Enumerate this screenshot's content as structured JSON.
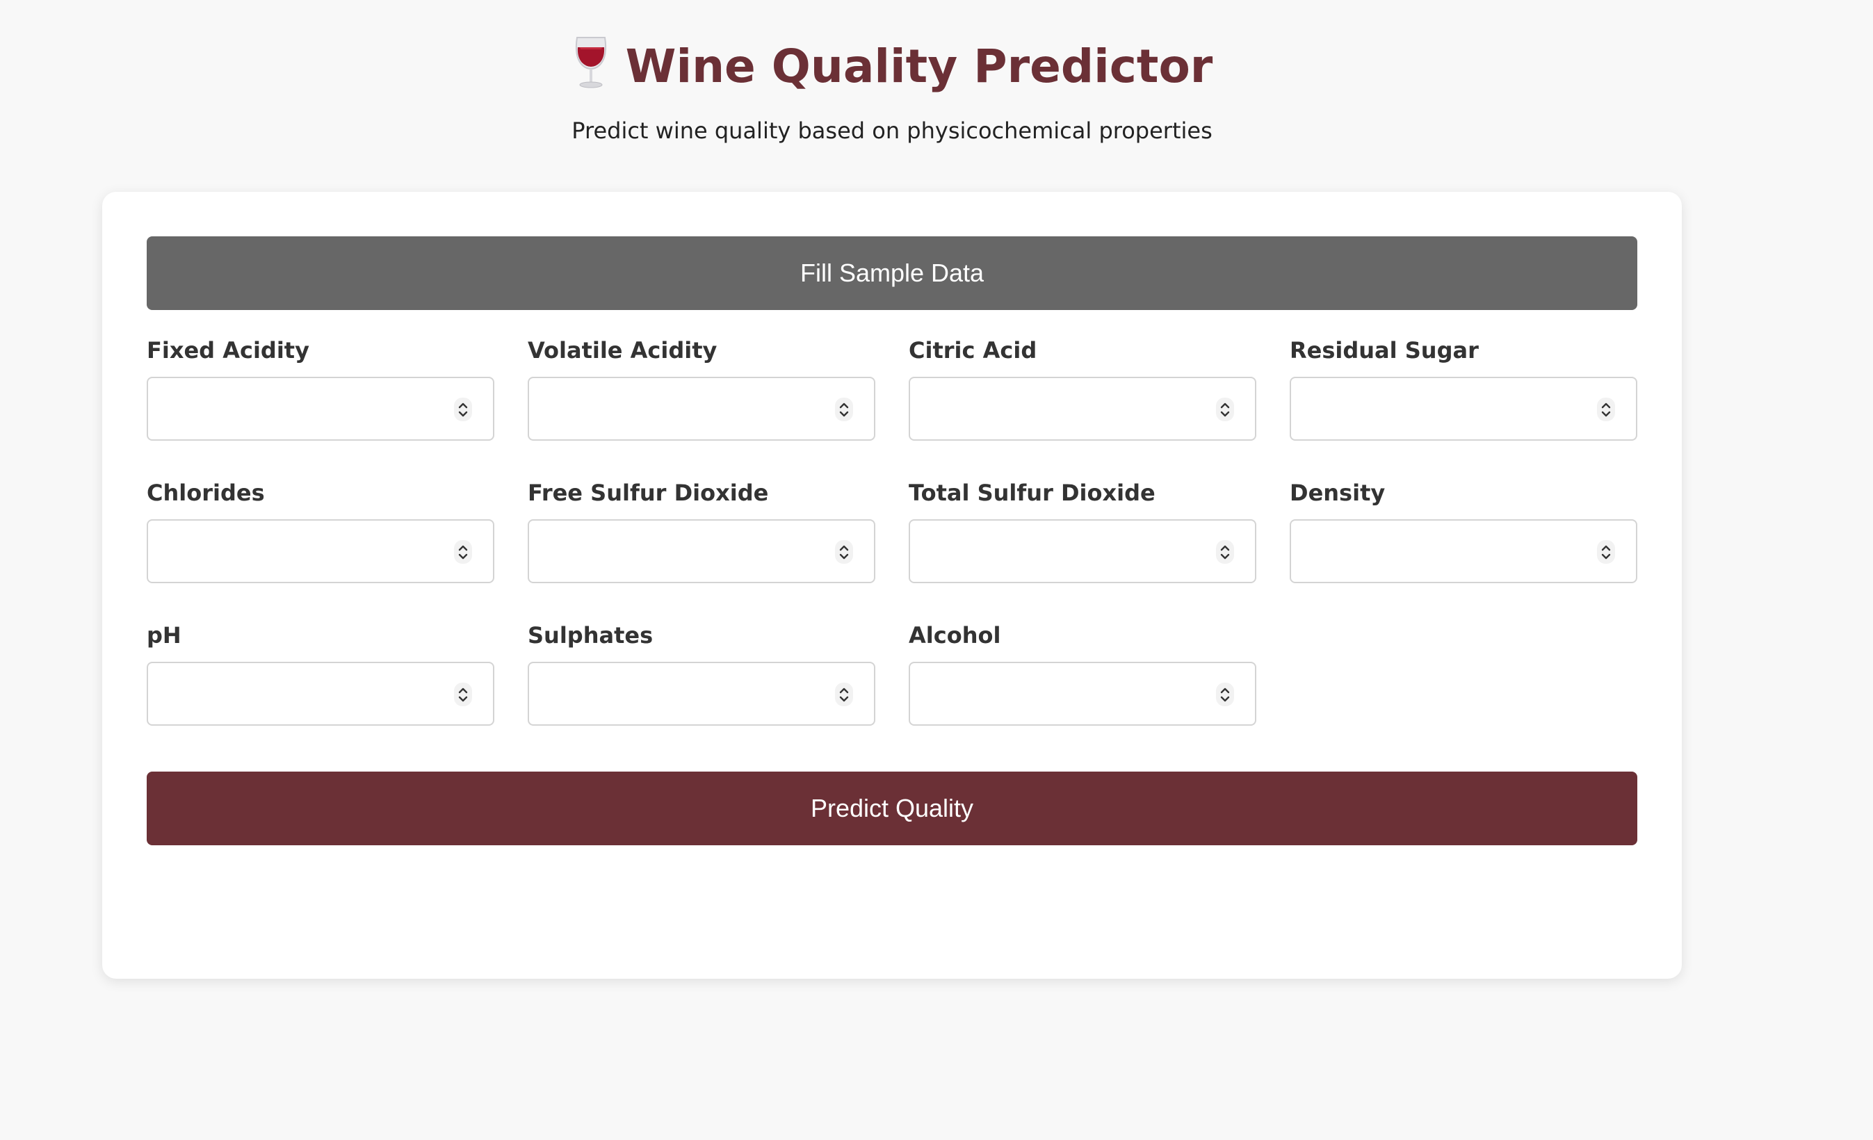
{
  "header": {
    "title": "Wine Quality Predictor",
    "subtitle": "Predict wine quality based on physicochemical properties",
    "icon": "wine-glass-icon"
  },
  "form": {
    "sample_button_label": "Fill Sample Data",
    "predict_button_label": "Predict Quality",
    "fields": [
      {
        "label": "Fixed Acidity",
        "value": "",
        "placeholder": ""
      },
      {
        "label": "Volatile Acidity",
        "value": "",
        "placeholder": ""
      },
      {
        "label": "Citric Acid",
        "value": "",
        "placeholder": ""
      },
      {
        "label": "Residual Sugar",
        "value": "",
        "placeholder": ""
      },
      {
        "label": "Chlorides",
        "value": "",
        "placeholder": ""
      },
      {
        "label": "Free Sulfur Dioxide",
        "value": "",
        "placeholder": ""
      },
      {
        "label": "Total Sulfur Dioxide",
        "value": "",
        "placeholder": ""
      },
      {
        "label": "Density",
        "value": "",
        "placeholder": ""
      },
      {
        "label": "pH",
        "value": "",
        "placeholder": ""
      },
      {
        "label": "Sulphates",
        "value": "",
        "placeholder": ""
      },
      {
        "label": "Alcohol",
        "value": "",
        "placeholder": ""
      }
    ]
  },
  "colors": {
    "brand": "#6b3036",
    "sample_button": "#676767",
    "background": "#f8f8f8"
  }
}
